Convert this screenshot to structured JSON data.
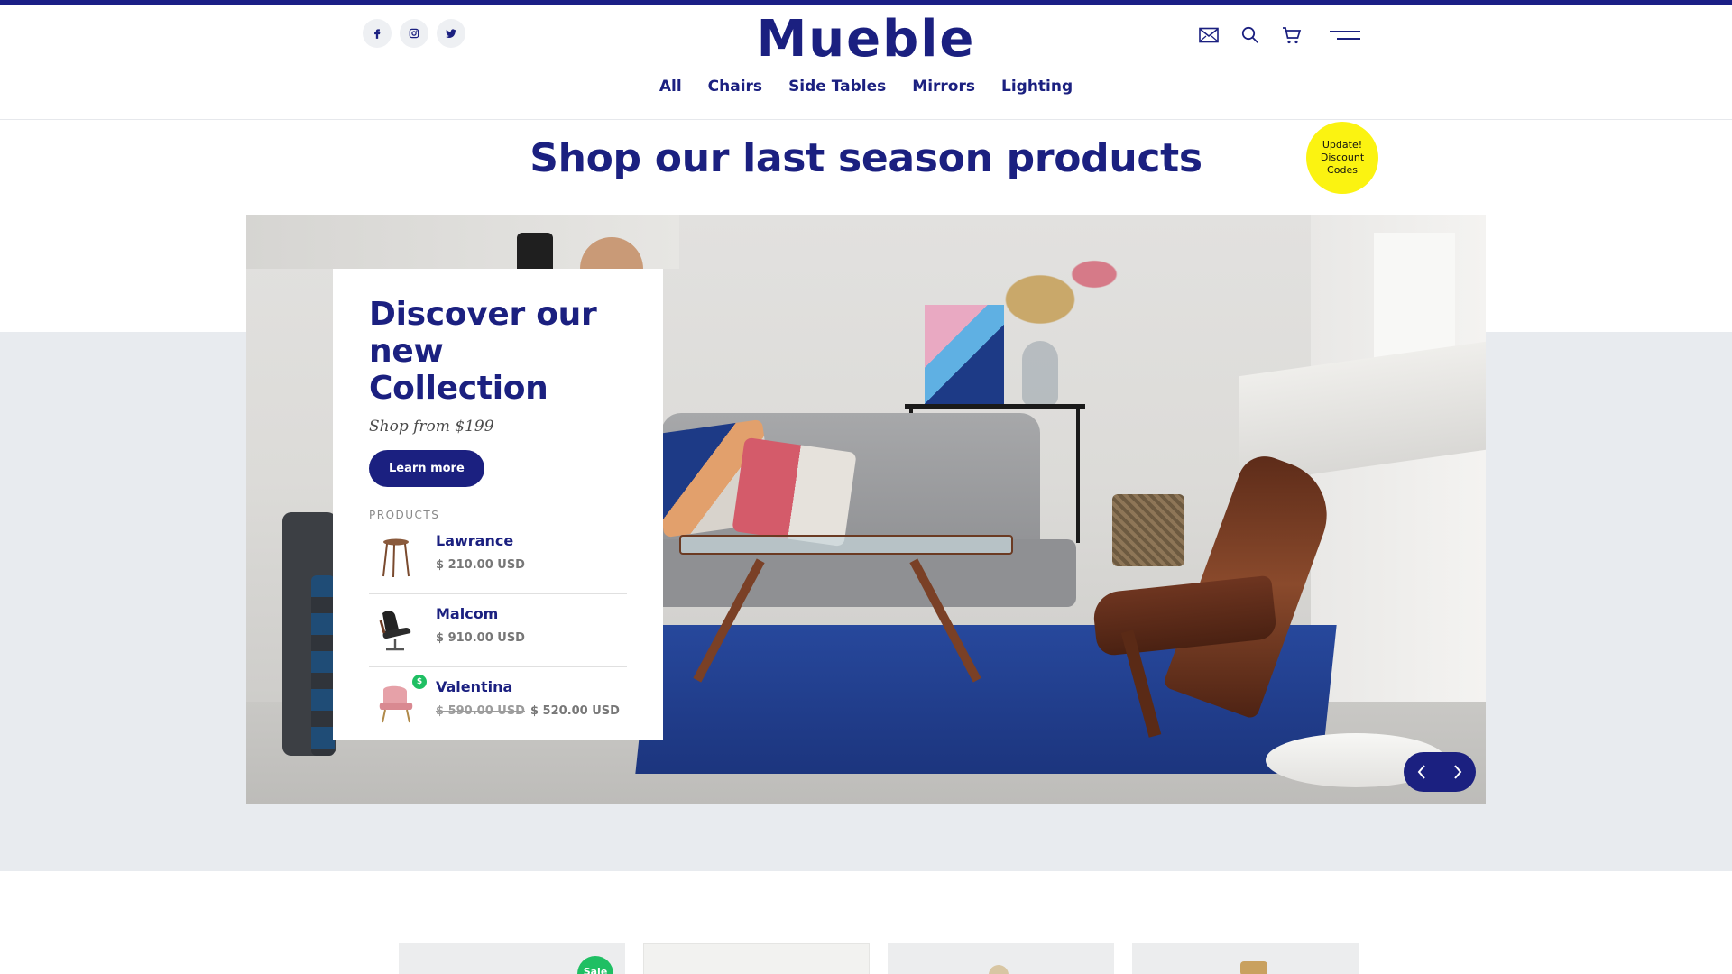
{
  "brand": {
    "logo": "Mueble",
    "accent": "#1b2080",
    "badge_color": "#fbf311",
    "sale_color": "#1fbf63"
  },
  "header": {
    "socials": [
      {
        "icon": "facebook-icon"
      },
      {
        "icon": "instagram-icon"
      },
      {
        "icon": "twitter-icon"
      }
    ],
    "actions": [
      {
        "icon": "mail-icon"
      },
      {
        "icon": "search-icon"
      },
      {
        "icon": "cart-icon"
      },
      {
        "icon": "menu-icon"
      }
    ],
    "nav": [
      "All",
      "Chairs",
      "Side Tables",
      "Mirrors",
      "Lighting"
    ]
  },
  "hero": {
    "title": "Shop our last season products",
    "badge": "Update! Discount Codes"
  },
  "card": {
    "title": "Discover our new Collection",
    "subtitle": "Shop from $199",
    "button": "Learn more",
    "products_label": "PRODUCTS",
    "products": [
      {
        "name": "Lawrance",
        "price": "$ 210.00 USD",
        "old_price": "",
        "sale_badge": ""
      },
      {
        "name": "Malcom",
        "price": "$ 910.00 USD",
        "old_price": "",
        "sale_badge": ""
      },
      {
        "name": "Valentina",
        "price": "$ 520.00 USD",
        "old_price": "$ 590.00 USD",
        "sale_badge": "$"
      }
    ]
  },
  "slider": {
    "prev_icon": "chevron-left-icon",
    "next_icon": "chevron-right-icon"
  },
  "grid": {
    "first_badge": "Sale"
  }
}
